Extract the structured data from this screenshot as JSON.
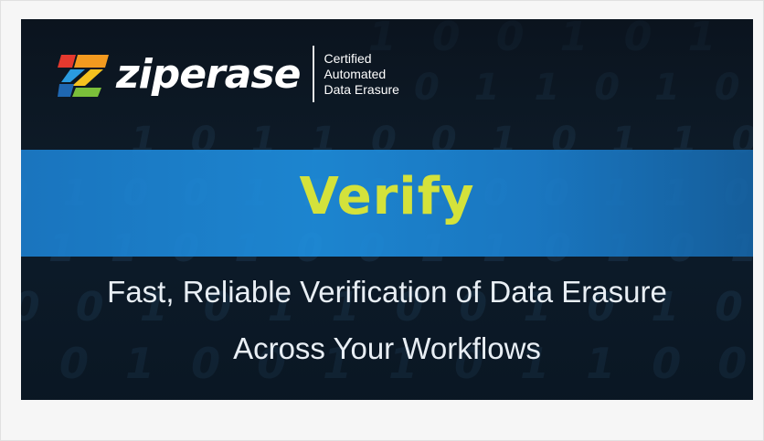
{
  "brand": {
    "name": "ziperase",
    "tagline": [
      "Certified",
      "Automated",
      "Data Erasure"
    ],
    "colors": {
      "headline": "#d4e23b",
      "band": "#1d89d6",
      "background": "#0f1d2b"
    }
  },
  "headline": "Verify",
  "subheadline": {
    "line1": "Fast, Reliable Verification of Data Erasure",
    "line2": "Across Your Workflows"
  },
  "background_binary": [
    "1 0 0 1 0 1 1 0 0 1 0 1 1 0",
    "0 1 1 0 1 0 0 1 1 0 1 1 0",
    "1 0 1 1 0 0 1 0 1 1 0 0 1",
    "0 1 0 0 1 1 0 1 0 0 1 1 0",
    "1 1 0 1 0 0 1 1 0 1 0 1 0",
    "0 0 1 0 1 1 0 0 1 0 1 0 1",
    "1 0 1 0 0 1 1 0 1 1 0 0 0"
  ]
}
